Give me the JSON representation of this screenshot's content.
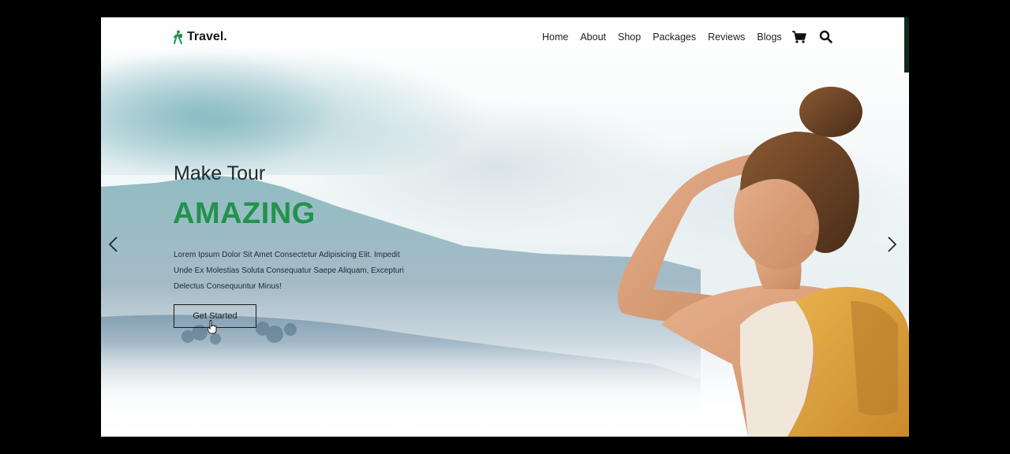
{
  "brand": {
    "name": "Travel.",
    "icon": "hiker-icon",
    "accent_color": "#22924c"
  },
  "nav": {
    "items": [
      "Home",
      "About",
      "Shop",
      "Packages",
      "Reviews",
      "Blogs"
    ],
    "icons": [
      "cart-icon",
      "search-icon"
    ]
  },
  "hero": {
    "subtitle": "Make Tour",
    "title": "AMAZING",
    "description_lines": [
      "Lorem Ipsum Dolor Sit Amet Consectetur Adipisicing Elit. Impedit",
      "Unde Ex Molestias Soluta Consequatur Saepe Aliquam, Excepturi",
      "Delectus Consequuntur Minus!"
    ],
    "cta_label": "Get Started"
  },
  "slider": {
    "prev_icon": "chevron-left-icon",
    "next_icon": "chevron-right-icon"
  }
}
